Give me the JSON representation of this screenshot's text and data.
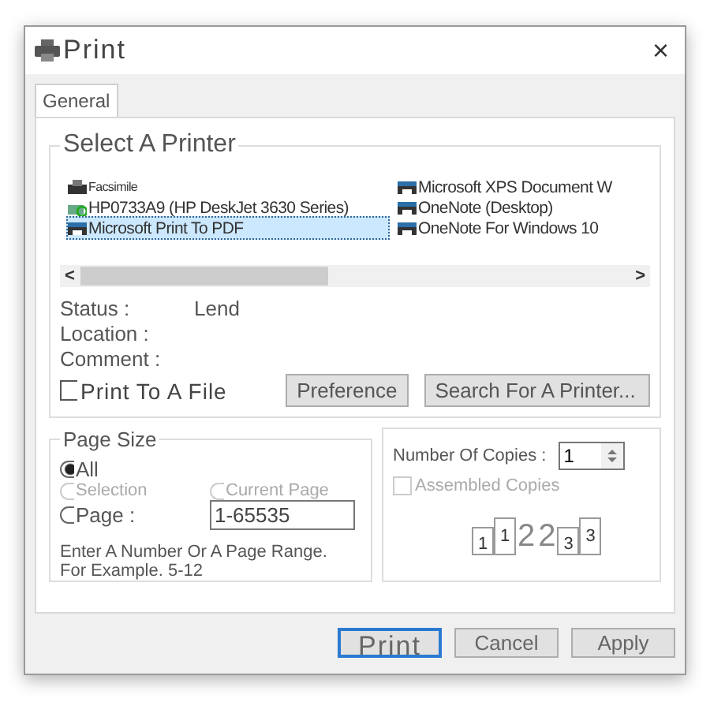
{
  "window": {
    "title": "Print",
    "close": "×"
  },
  "tabs": [
    {
      "label": "General",
      "selected": true
    }
  ],
  "printer_group": {
    "title": "Select A Printer",
    "printers": [
      {
        "name": "Facsimile",
        "kind": "fax",
        "selected": false
      },
      {
        "name": "HP0733A9 (HP DeskJet 3630 Series)",
        "kind": "network",
        "selected": false
      },
      {
        "name": "Microsoft Print To PDF",
        "kind": "printer",
        "selected": true
      },
      {
        "name": "Microsoft XPS Document W",
        "kind": "printer",
        "selected": false
      },
      {
        "name": "OneNote (Desktop)",
        "kind": "printer",
        "selected": false
      },
      {
        "name": "OneNote For Windows 10",
        "kind": "printer",
        "selected": false
      }
    ],
    "scroll_left": "<",
    "scroll_right": ">",
    "info": [
      {
        "label": "Status :",
        "value": "Lend"
      },
      {
        "label": "Location :"
      },
      {
        "label": "Comment :"
      }
    ],
    "print_to_file": {
      "label": "Print To A File",
      "checked": false
    },
    "buttons": [
      "Preference",
      "Search For A Printer..."
    ]
  },
  "page_range": {
    "title": "Page Size",
    "options": [
      {
        "label": "All",
        "selected": true,
        "disabled": false
      },
      {
        "label": "Selection",
        "selected": false,
        "disabled": true
      },
      {
        "label": "Current Page",
        "selected": false,
        "disabled": true
      },
      {
        "label": "Page :",
        "selected": false,
        "disabled": false
      }
    ],
    "range_value": "1-65535",
    "hint": [
      "Enter A Number Or A Page Range.",
      "For Example. 5-12"
    ]
  },
  "copies": {
    "label": "Number Of Copies :",
    "value": "1",
    "collate": {
      "label": "Assembled Copies",
      "checked": false,
      "disabled": true
    },
    "page_numbers": [
      "1",
      "1",
      "2",
      "2",
      "3",
      "3"
    ]
  },
  "footer_buttons": [
    {
      "label": "Print",
      "default": true
    },
    {
      "label": "Cancel",
      "default": false
    },
    {
      "label": "Apply",
      "default": false
    }
  ]
}
